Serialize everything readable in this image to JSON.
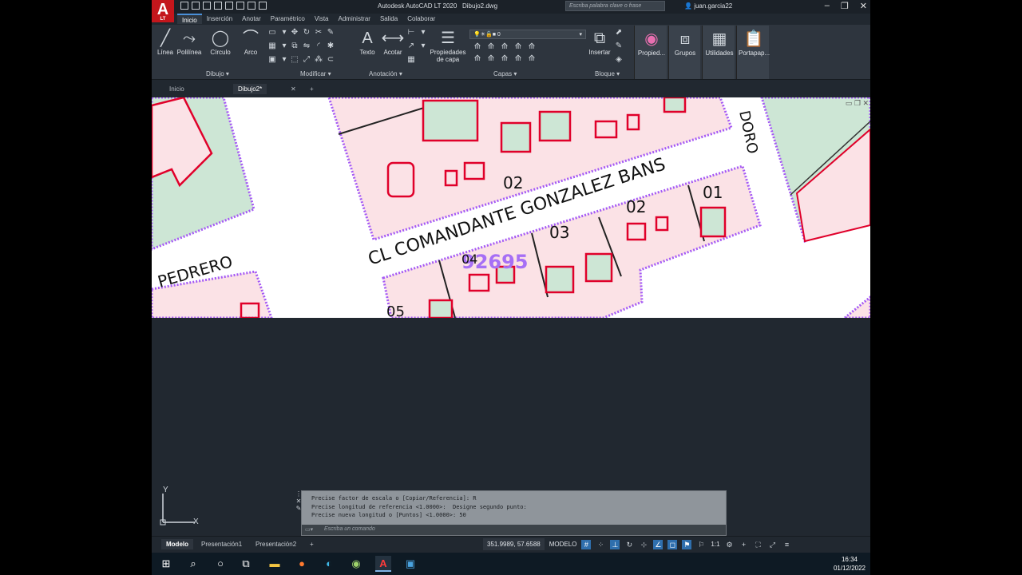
{
  "title_bar": {
    "logo_letter": "A",
    "logo_sub": "LT",
    "app_title": "Autodesk AutoCAD LT 2020",
    "file_name": "Dibujo2.dwg",
    "search_placeholder": "Escriba palabra clave o frase",
    "user": "juan.garcia22"
  },
  "menu_tabs": [
    "Inicio",
    "Inserción",
    "Anotar",
    "Paramétrico",
    "Vista",
    "Administrar",
    "Salida",
    "Colaborar"
  ],
  "ribbon": {
    "dibujo": {
      "label": "Dibujo",
      "tools": [
        "Línea",
        "Polilínea",
        "Círculo",
        "Arco"
      ]
    },
    "modificar": {
      "label": "Modificar"
    },
    "anotacion": {
      "label": "Anotación",
      "tools": [
        "Texto",
        "Acotar"
      ]
    },
    "capas": {
      "label": "Capas",
      "props": "Propiedades\nde capa",
      "layer_current": "0"
    },
    "bloque": {
      "label": "Bloque",
      "insert": "Insertar"
    },
    "extra": [
      "Propied...",
      "Grupos",
      "Utilidades",
      "Portapap..."
    ]
  },
  "doc_tabs": [
    "Inicio",
    "Dibujo2*"
  ],
  "drawing": {
    "street1": "CL COMANDANTE GONZALEZ BANS",
    "street2": "PEDRERO",
    "street3": "DORO",
    "block_number": "92695",
    "parcels": [
      "02",
      "01",
      "02",
      "03",
      "04",
      "05"
    ]
  },
  "command_line": {
    "history": [
      "Precise factor de escala o [Copiar/Referencia]: R",
      "Precise longitud de referencia <1.0000>:  Designe segundo punto:",
      "Precise nueva longitud o [Puntos] <1.0000>: 50"
    ],
    "placeholder": "Escriba un comando"
  },
  "layout_tabs": [
    "Modelo",
    "Presentación1",
    "Presentación2"
  ],
  "status": {
    "coords": "351.9989, 57.6588",
    "mode": "MODELO",
    "scale": "1:1"
  },
  "ucs": {
    "x": "X",
    "y": "Y"
  },
  "clock": {
    "time": "16:34",
    "date": "01/12/2022"
  },
  "colors": {
    "accent": "#2f6fad",
    "parcel_fill": "#fbe2e6",
    "parcel_border": "#a55af5",
    "green": "#cde6d5",
    "building": "#e0002a"
  }
}
